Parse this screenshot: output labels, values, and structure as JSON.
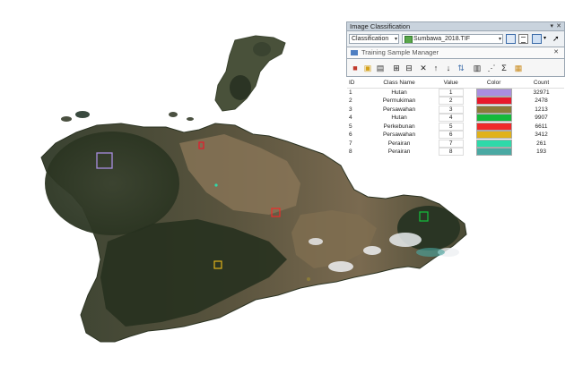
{
  "image_classification": {
    "title": "Image Classification",
    "classification_menu": "Classification",
    "raster_layer": "Sumbawa_2018.TIF"
  },
  "training_sample_manager": {
    "title": "Training Sample Manager",
    "columns": [
      "ID",
      "Class Name",
      "Value",
      "Color",
      "Count"
    ],
    "rows": [
      {
        "id": "1",
        "name": "Hutan",
        "value": "1",
        "color": "#a98ee0",
        "count": "32971"
      },
      {
        "id": "2",
        "name": "Permukiman",
        "value": "2",
        "color": "#e8192c",
        "count": "2478"
      },
      {
        "id": "3",
        "name": "Persawahan",
        "value": "3",
        "color": "#8a7b3a",
        "count": "1213"
      },
      {
        "id": "4",
        "name": "Hutan",
        "value": "4",
        "color": "#14b93b",
        "count": "9907"
      },
      {
        "id": "5",
        "name": "Perkebunan",
        "value": "5",
        "color": "#ef2a2a",
        "count": "6611"
      },
      {
        "id": "6",
        "name": "Persawahan",
        "value": "6",
        "color": "#e0b21a",
        "count": "3412"
      },
      {
        "id": "7",
        "name": "Perairan",
        "value": "7",
        "color": "#2fd9a9",
        "count": "261"
      },
      {
        "id": "8",
        "name": "Perairan",
        "value": "8",
        "color": "#4aa9a3",
        "count": "193"
      }
    ]
  },
  "colors": {
    "window_border": "#9aa6b2",
    "land_dark": "#2f3a26",
    "land_brown": "#7e6b52"
  },
  "icons": [
    "pin-icon",
    "close-icon",
    "dropdown-arrow-icon",
    "layer-icon",
    "table-icon",
    "training-sample-icon"
  ]
}
